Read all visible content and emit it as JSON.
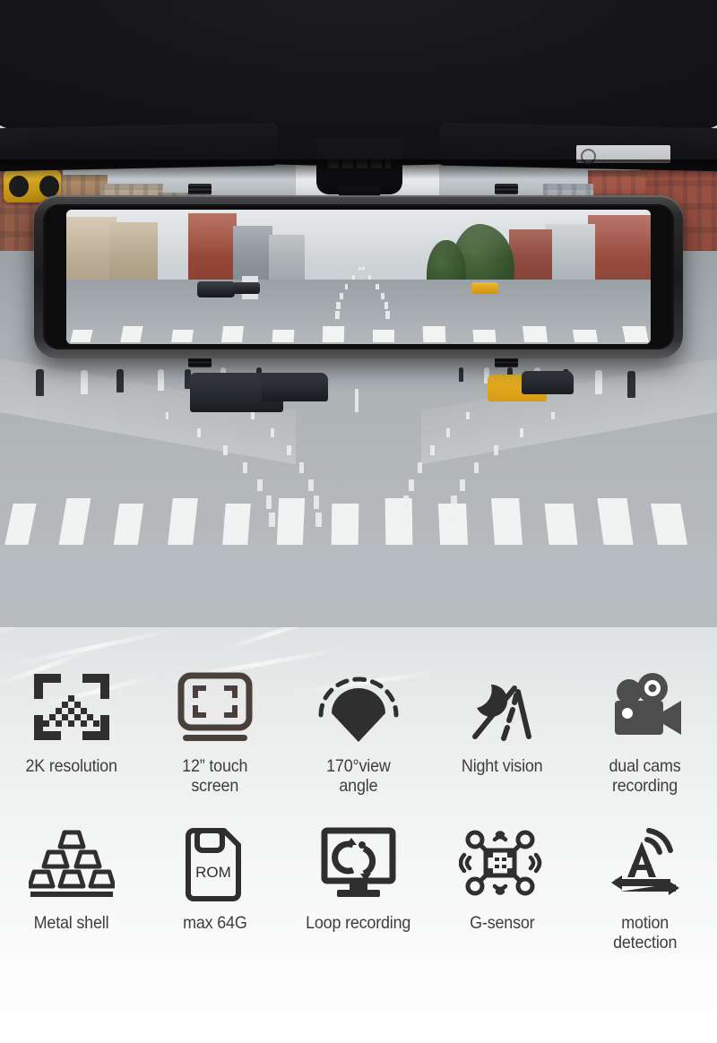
{
  "product": {
    "type": "mirror-dashcam-feature-board",
    "hero": {
      "scene": "city street viewed through car windshield",
      "device": "rearview mirror dash cam with full-width touchscreen",
      "screen_scene": "live road view shown on the mirror screen"
    }
  },
  "features": {
    "row1": [
      {
        "icon": "resolution-frame-icon",
        "label": "2K resolution"
      },
      {
        "icon": "touch-screen-icon",
        "label": "12” touch\nscreen"
      },
      {
        "icon": "view-angle-icon",
        "label": "170°view\nangle"
      },
      {
        "icon": "night-vision-icon",
        "label": "Night vision"
      },
      {
        "icon": "video-camera-icon",
        "label": "dual cams\nrecording"
      }
    ],
    "row2": [
      {
        "icon": "metal-ingots-icon",
        "label": "Metal shell"
      },
      {
        "icon": "memory-card-icon",
        "label": "max 64G",
        "icon_text": "ROM"
      },
      {
        "icon": "loop-recording-icon",
        "label": "Loop recording"
      },
      {
        "icon": "g-sensor-icon",
        "label": "G-sensor"
      },
      {
        "icon": "motion-detection-icon",
        "label": "motion\ndetection"
      }
    ]
  },
  "colors": {
    "icon_dark": "#3a3a3a",
    "icon_brown": "#4a3f3b",
    "label_text": "#3d3d3d",
    "panel_top": "#dfe2e3",
    "panel_bottom": "#ffffff",
    "mirror_bezel": "#232326"
  }
}
